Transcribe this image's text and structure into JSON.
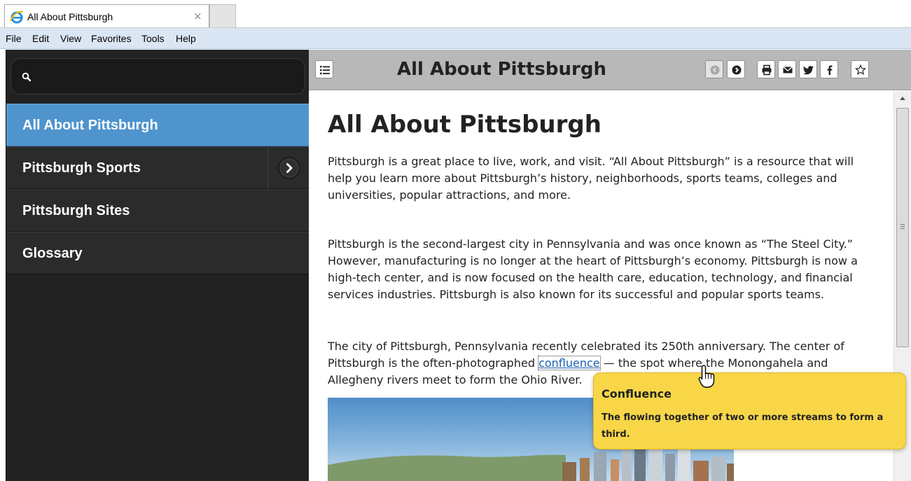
{
  "browser": {
    "tab_title": "All About Pittsburgh",
    "close_glyph": "×",
    "menu": [
      "File",
      "Edit",
      "View",
      "Favorites",
      "Tools",
      "Help"
    ]
  },
  "sidebar": {
    "search_placeholder": "",
    "items": [
      {
        "label": "All About Pittsburgh",
        "active": true
      },
      {
        "label": "Pittsburgh Sports",
        "has_arrow": true
      },
      {
        "label": "Pittsburgh Sites"
      },
      {
        "label": "Glossary"
      }
    ]
  },
  "header": {
    "title": "All About Pittsburgh",
    "buttons": [
      "toc-icon",
      "back-icon",
      "forward-icon",
      "print-icon",
      "email-icon",
      "twitter-icon",
      "facebook-icon",
      "star-icon"
    ]
  },
  "content": {
    "title": "All About Pittsburgh",
    "p1": "Pittsburgh is a great place to live, work, and visit. “All About Pittsburgh” is a resource that will help you learn more about Pittsburgh’s history, neighborhoods, sports teams, colleges and universities, popular attractions, and more.",
    "p2": "Pittsburgh is the second-largest city in Pennsylvania and was once known as “The Steel City.” However, manufacturing is no longer at the heart of Pittsburgh’s economy. Pittsburgh is now a high-tech center, and is now focused on the health care, education, technology, and financial services industries. Pittsburgh is also known for its successful and popular sports teams.",
    "p3_before": "The city of Pittsburgh, Pennsylvania recently celebrated its 250th anniversary. The center of Pittsburgh is the often-photographed ",
    "p3_link": "confluence",
    "p3_after": " — the spot where the Monongahela and Allegheny rivers meet to form the Ohio River."
  },
  "tooltip": {
    "title": "Confluence",
    "body": "The flowing together of two or more streams to form a third."
  },
  "colors": {
    "sidebar_bg": "#222222",
    "active_item": "#4f94cd",
    "header_bg": "#b8b8b8",
    "tooltip_bg": "#f8d648",
    "link": "#1a5fb4"
  }
}
